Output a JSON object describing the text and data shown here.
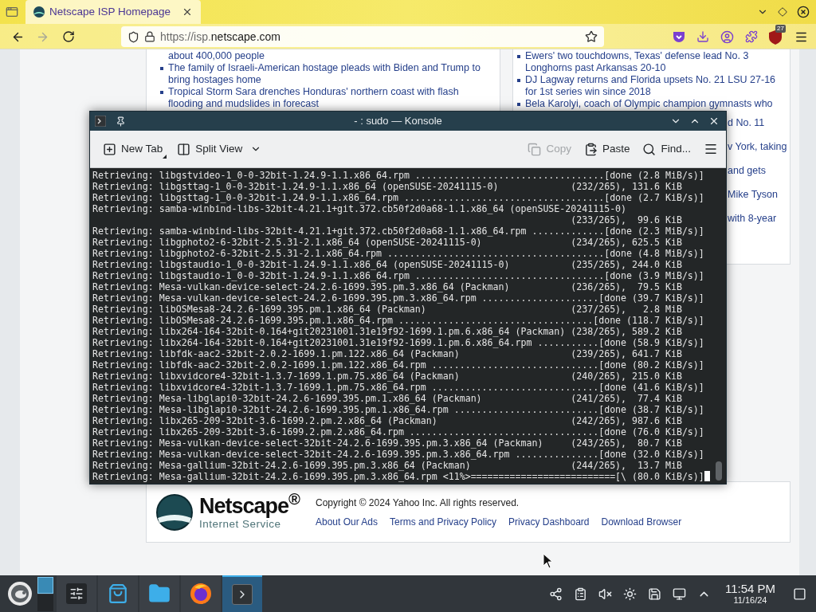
{
  "browser": {
    "tab": {
      "title": "Netscape ISP Homepage",
      "selected": true
    },
    "nav": {
      "back_disabled": false,
      "forward_disabled": true
    },
    "url": {
      "prefix": "https://isp.",
      "domain": "netscape.com"
    },
    "extension_badge": "27"
  },
  "page": {
    "left_news": [
      {
        "text": "about 400,000 people",
        "bullet": false
      },
      {
        "text": "The family of Israeli-American hostage pleads with Biden and Trump to bring hostages home",
        "bullet": true
      },
      {
        "text": "Tropical Storm Sara drenches Honduras' northern coast with flash flooding and mudslides in forecast",
        "bullet": true
      }
    ],
    "right_news": [
      {
        "text": "Ewers' two touchdowns, Texas' defense lead No. 3 Longhorns past Arkansas 20-10",
        "bullet": true
      },
      {
        "text": "DJ Lagway returns and Florida upsets No. 21 LSU 27-16 for 1st series win since 2018",
        "bullet": true
      },
      {
        "text": "Bela Karolyi, coach of Olympic champion gymnasts who",
        "bullet": true
      }
    ],
    "right_fragments": [
      "d No. 11",
      "v York, taking",
      "and gets",
      "Mike Tyson",
      "with 8-year"
    ],
    "footer": {
      "logo_name": "Netscape$^{®}$",
      "logo_subtitle": "Internet Service",
      "copyright": "Copyright © 2024 Yahoo Inc. All rights reserved.",
      "links": [
        "About Our Ads",
        "Terms and Privacy Policy",
        "Privacy Dashboard",
        "Download Browser"
      ]
    }
  },
  "konsole": {
    "title": "- : sudo — Konsole",
    "toolbar": [
      {
        "label": "New Tab",
        "kind": "new-tab",
        "disabled": false
      },
      {
        "label": "Split View",
        "kind": "split",
        "disabled": false
      },
      {
        "label": "Copy",
        "kind": "copy",
        "disabled": true
      },
      {
        "label": "Paste",
        "kind": "paste",
        "disabled": false
      },
      {
        "label": "Find...",
        "kind": "find",
        "disabled": false
      }
    ],
    "lines": [
      "Retrieving: libgstvideo-1_0-0-32bit-1.24.9-1.1.x86_64.rpm ..................................[done (2.8 MiB/s)]",
      "Retrieving: libgsttag-1_0-0-32bit-1.24.9-1.1.x86_64 (openSUSE-20241115-0)             (232/265), 131.6 KiB",
      "Retrieving: libgsttag-1_0-0-32bit-1.24.9-1.1.x86_64.rpm ....................................[done (2.7 KiB/s)]",
      "Retrieving: samba-winbind-libs-32bit-4.21.1+git.372.cb50f2d0a68-1.1.x86_64 (openSUSE-20241115-0)",
      "                                                                                      (233/265),  99.6 KiB",
      "Retrieving: samba-winbind-libs-32bit-4.21.1+git.372.cb50f2d0a68-1.1.x86_64.rpm .............[done (2.3 MiB/s)]",
      "Retrieving: libgphoto2-6-32bit-2.5.31-2.1.x86_64 (openSUSE-20241115-0)                (234/265), 625.5 KiB",
      "Retrieving: libgphoto2-6-32bit-2.5.31-2.1.x86_64.rpm .......................................[done (4.8 MiB/s)]",
      "Retrieving: libgstaudio-1_0-0-32bit-1.24.9-1.1.x86_64 (openSUSE-20241115-0)           (235/265), 244.0 KiB",
      "Retrieving: libgstaudio-1_0-0-32bit-1.24.9-1.1.x86_64.rpm ..................................[done (3.9 MiB/s)]",
      "Retrieving: Mesa-vulkan-device-select-24.2.6-1699.395.pm.3.x86_64 (Packman)           (236/265),  79.5 KiB",
      "Retrieving: Mesa-vulkan-device-select-24.2.6-1699.395.pm.3.x86_64.rpm .....................[done (39.7 KiB/s)]",
      "Retrieving: libOSMesa8-24.2.6-1699.395.pm.1.x86_64 (Packman)                          (237/265),   2.8 MiB",
      "Retrieving: libOSMesa8-24.2.6-1699.395.pm.1.x86_64.rpm ...................................[done (118.7 KiB/s)]",
      "Retrieving: libx264-164-32bit-0.164+git20231001.31e19f92-1699.1.pm.6.x86_64 (Packman) (238/265), 589.2 KiB",
      "Retrieving: libx264-164-32bit-0.164+git20231001.31e19f92-1699.1.pm.6.x86_64.rpm ...........[done (58.9 KiB/s)]",
      "Retrieving: libfdk-aac2-32bit-2.0.2-1699.1.pm.122.x86_64 (Packman)                    (239/265), 641.7 KiB",
      "Retrieving: libfdk-aac2-32bit-2.0.2-1699.1.pm.122.x86_64.rpm ..............................[done (80.2 KiB/s)]",
      "Retrieving: libxvidcore4-32bit-1.3.7-1699.1.pm.75.x86_64 (Packman)                    (240/265), 215.0 KiB",
      "Retrieving: libxvidcore4-32bit-1.3.7-1699.1.pm.75.x86_64.rpm ..............................[done (41.6 KiB/s)]",
      "Retrieving: Mesa-libglapi0-32bit-24.2.6-1699.395.pm.1.x86_64 (Packman)                (241/265),  77.4 KiB",
      "Retrieving: Mesa-libglapi0-32bit-24.2.6-1699.395.pm.1.x86_64.rpm ..........................[done (38.7 KiB/s)]",
      "Retrieving: libx265-209-32bit-3.6-1699.2.pm.2.x86_64 (Packman)                        (242/265), 987.6 KiB",
      "Retrieving: libx265-209-32bit-3.6-1699.2.pm.2.x86_64.rpm ..................................[done (76.0 KiB/s)]",
      "Retrieving: Mesa-vulkan-device-select-32bit-24.2.6-1699.395.pm.3.x86_64 (Packman)     (243/265),  80.7 KiB",
      "Retrieving: Mesa-vulkan-device-select-32bit-24.2.6-1699.395.pm.3.x86_64.rpm ...............[done (32.0 KiB/s)]",
      "Retrieving: Mesa-gallium-32bit-24.2.6-1699.395.pm.3.x86_64 (Packman)                  (244/265),  13.7 MiB",
      "Retrieving: Mesa-gallium-32bit-24.2.6-1699.395.pm.3.x86_64.rpm <11%>==========================[\\ (80.0 KiB/s)]"
    ],
    "cursor": true
  },
  "taskbar": {
    "desktops": [
      {
        "selected": true
      },
      {
        "selected": false
      }
    ],
    "tasks": [
      {
        "kind": "settings",
        "selected": false
      },
      {
        "kind": "discover",
        "selected": false
      },
      {
        "kind": "files",
        "selected": false
      },
      {
        "kind": "firefox",
        "selected": false
      },
      {
        "kind": "terminal",
        "selected": true
      }
    ],
    "tray": [
      {
        "kind": "connect"
      },
      {
        "kind": "clipboard"
      },
      {
        "kind": "volume-muted"
      },
      {
        "kind": "brightness"
      },
      {
        "kind": "disk"
      },
      {
        "kind": "network"
      },
      {
        "kind": "expand"
      }
    ],
    "time": "11:54 PM",
    "date": "11/16/24"
  }
}
